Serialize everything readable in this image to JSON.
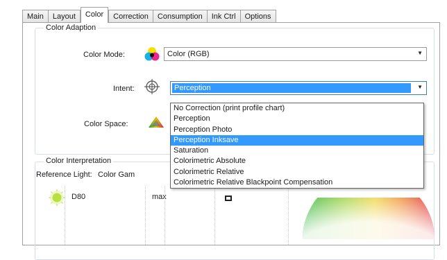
{
  "tabs": [
    "Main",
    "Layout",
    "Color",
    "Correction",
    "Consumption",
    "Ink Ctrl",
    "Options"
  ],
  "active_tab": "Color",
  "color_adaption": {
    "title": "Color Adaption",
    "color_mode_label": "Color Mode:",
    "color_mode_value": "Color (RGB)",
    "intent_label": "Intent:",
    "intent_value": "Perception",
    "color_space_label": "Color Space:"
  },
  "intent_options": [
    "No Correction (print profile chart)",
    "Perception",
    "Perception Photo",
    "Perception Inksave",
    "Saturation",
    "Colorimetric Absolute",
    "Colorimetric Relative",
    "Colorimetric Relative Blackpoint Compensation"
  ],
  "highlighted_option": "Perception Inksave",
  "color_interpretation": {
    "title": "Color Interpretation",
    "reference_light_label": "Reference Light:",
    "color_gamut_label": "Color Gam",
    "light_value": "D80",
    "gamut_value": "max"
  },
  "icons": {
    "color_mode": "cmy-circles-icon",
    "intent": "crosshair-target-icon",
    "color_space": "color-triangle-icon",
    "reference_light": "light-bulb-icon",
    "color_wheel": "color-wheel-icon"
  }
}
